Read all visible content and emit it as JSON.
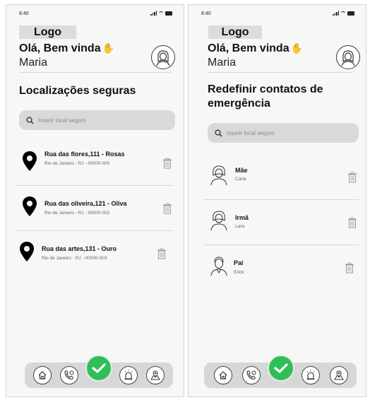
{
  "status": {
    "time": "8:40"
  },
  "header": {
    "logo": "Logo",
    "greeting": "Olá, Bem vinda",
    "user_name": "Maria"
  },
  "left_screen": {
    "title": "Localizações seguras",
    "search_placeholder": "Inserir local seguro",
    "locations": [
      {
        "street": "Rua das flores,111 - Rosas",
        "address": "Rio de Janeiro - RJ - 00000-000"
      },
      {
        "street": "Rua das oliveira,121 - Oliva",
        "address": "Rio de Janeiro - RJ - 00000-002"
      },
      {
        "street": "Rua das artes,131 - Ouro",
        "address": "Rio de Janeiro - RJ - 00000-003"
      }
    ]
  },
  "right_screen": {
    "title": "Redefinir contatos de emergência",
    "search_placeholder": "Inserir local seguro",
    "contacts": [
      {
        "relation": "Mãe",
        "name": "Carla"
      },
      {
        "relation": "Irmã",
        "name": "Lara"
      },
      {
        "relation": "Pai",
        "name": "Erick"
      }
    ]
  },
  "nav": {
    "items": [
      "home-icon",
      "phone-call-icon",
      "check-icon",
      "alarm-icon",
      "map-profile-icon"
    ]
  },
  "colors": {
    "accent_green": "#2fbf57",
    "search_bg": "#d9d9d9",
    "nav_bg": "#d7d7d7"
  }
}
